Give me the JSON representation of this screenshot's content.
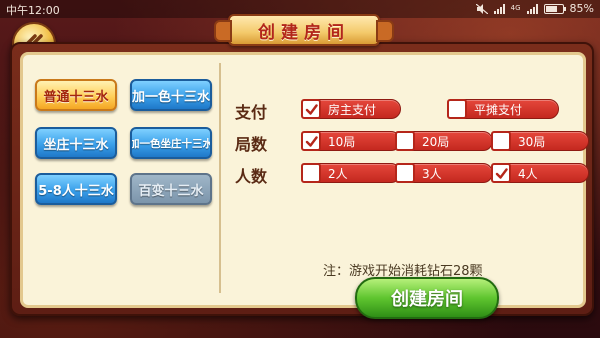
{
  "status_bar": {
    "time": "中午12:00",
    "battery_percent_label": "85%",
    "battery_level": 0.85,
    "icons": [
      "mute-icon",
      "signal-icon",
      "network-4g-icon",
      "signal-icon",
      "battery-icon"
    ]
  },
  "title": "创建房间",
  "modes": [
    {
      "label": "普通十三水",
      "state": "selected"
    },
    {
      "label": "加一色十三水",
      "state": "normal"
    },
    {
      "label": "坐庄十三水",
      "state": "normal"
    },
    {
      "label": "加一色坐庄十三水",
      "state": "normal"
    },
    {
      "label": "5-8人十三水",
      "state": "normal"
    },
    {
      "label": "百变十三水",
      "state": "disabled"
    }
  ],
  "options": {
    "payment": {
      "label": "支付",
      "choices": [
        {
          "label": "房主支付",
          "checked": true
        },
        {
          "label": "平摊支付",
          "checked": false
        }
      ]
    },
    "rounds": {
      "label": "局数",
      "choices": [
        {
          "label": "10局",
          "checked": true
        },
        {
          "label": "20局",
          "checked": false
        },
        {
          "label": "30局",
          "checked": false
        }
      ]
    },
    "players": {
      "label": "人数",
      "choices": [
        {
          "label": "2人",
          "checked": false
        },
        {
          "label": "3人",
          "checked": false
        },
        {
          "label": "4人",
          "checked": true
        }
      ]
    }
  },
  "note": "注：游戏开始消耗钻石28颗",
  "create_button": "创建房间",
  "colors": {
    "accent_red": "#c4281f",
    "selected_gold": "#ffd05a",
    "mode_blue": "#3aa0ea",
    "create_green": "#5fc52f"
  }
}
